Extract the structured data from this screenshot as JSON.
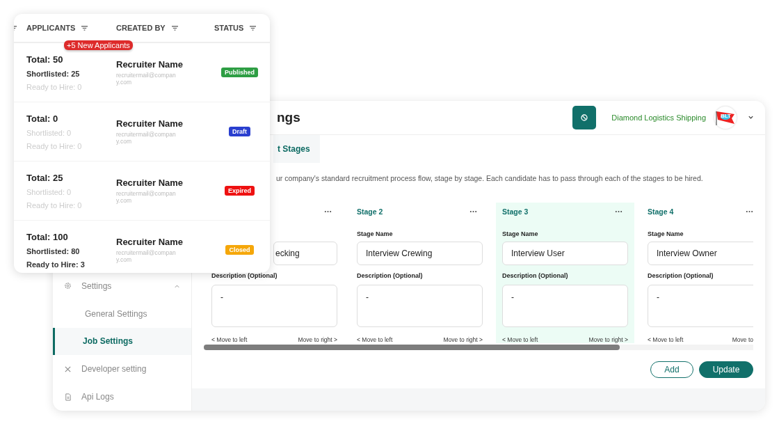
{
  "settings_window": {
    "title": "ngs",
    "company": "Diamond Logistics Shipping",
    "logo_text": "BLT",
    "sidebar": [
      {
        "label": "Settings",
        "kind": "group",
        "expanded": true,
        "children": [
          {
            "label": "General Settings",
            "selected": false
          },
          {
            "label": "Job Settings",
            "selected": true
          }
        ]
      },
      {
        "label": "Developer setting",
        "kind": "link"
      },
      {
        "label": "Api Logs",
        "kind": "link"
      }
    ],
    "tabs": [
      {
        "label": "t Stages",
        "selected": true
      }
    ],
    "description": "ur company's standard recruitment process flow, stage by stage. Each candidate has to pass through each of the stages to be hired.",
    "stages": [
      {
        "name": "ecking",
        "description_label": "Description (Optional)",
        "description": "-",
        "move_left": "< Move to left",
        "move_right": "Move to right >",
        "selected": false
      },
      {
        "title": "Stage 2",
        "name_label": "Stage Name",
        "name": "Interview Crewing",
        "description_label": "Description (Optional)",
        "description": "-",
        "move_left": "< Move to left",
        "move_right": "Move to right >",
        "selected": false
      },
      {
        "title": "Stage 3",
        "name_label": "Stage Name",
        "name": "Interview User",
        "description_label": "Description (Optional)",
        "description": "-",
        "move_left": "< Move to left",
        "move_right": "Move to right >",
        "selected": true
      },
      {
        "title": "Stage 4",
        "name_label": "Stage Name",
        "name": "Interview Owner",
        "description_label": "Description (Optional)",
        "description": "-",
        "move_left": "< Move to left",
        "move_right": "Move to",
        "selected": false
      }
    ],
    "buttons": [
      {
        "label": "Add",
        "kind": "secondary"
      },
      {
        "label": "Update",
        "kind": "primary"
      }
    ]
  },
  "applicants_card": {
    "columns": [
      {
        "label": "APPLICANTS"
      },
      {
        "label": "CREATED BY"
      },
      {
        "label": "STATUS"
      }
    ],
    "rows": [
      {
        "total": "Total: 50",
        "new_badge": "+5 New Applicants",
        "stats": [
          {
            "text": "Shortlisted: 25",
            "highlighted": true
          },
          {
            "text": "Ready to Hire: 0",
            "highlighted": false
          }
        ],
        "recruiter": "Recruiter Name",
        "email": "recruitermail@company.com",
        "status": {
          "label": "Published",
          "color": "#2e9e44"
        }
      },
      {
        "total": "Total: 0",
        "stats": [
          {
            "text": "Shortlisted: 0",
            "highlighted": false
          },
          {
            "text": "Ready to Hire: 0",
            "highlighted": false
          }
        ],
        "recruiter": "Recruiter Name",
        "email": "recruitermail@company.com",
        "status": {
          "label": "Draft",
          "color": "#2a3fcf"
        }
      },
      {
        "total": "Total: 25",
        "stats": [
          {
            "text": "Shortlisted: 0",
            "highlighted": false
          },
          {
            "text": "Ready to Hire: 0",
            "highlighted": false
          }
        ],
        "recruiter": "Recruiter Name",
        "email": "recruitermail@company.com",
        "status": {
          "label": "Expired",
          "color": "#ee1111"
        }
      },
      {
        "total": "Total: 100",
        "stats": [
          {
            "text": "Shortlisted: 80",
            "highlighted": true
          },
          {
            "text": "Ready to Hire: 3",
            "highlighted": true
          }
        ],
        "recruiter": "Recruiter Name",
        "email": "recruitermail@company.com",
        "status": {
          "label": "Closed",
          "color": "#f5a70a"
        }
      }
    ]
  }
}
